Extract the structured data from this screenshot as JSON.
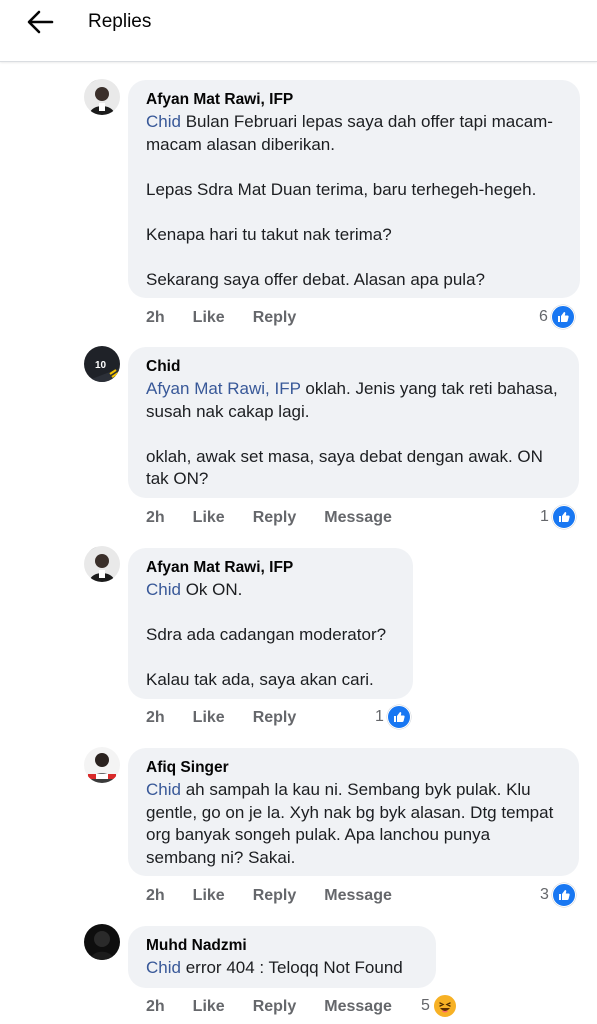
{
  "header": {
    "title": "Replies"
  },
  "comments": [
    {
      "author": "Afyan Mat Rawi, IFP",
      "mention": "Chid",
      "paragraphs": [
        "Bulan Februari lepas saya dah offer tapi macam-macam alasan diberikan.",
        "Lepas Sdra Mat Duan terima, baru terhegeh-hegeh.",
        "Kenapa hari tu takut nak terima?",
        "Sekarang saya offer debat. Alasan apa pula?"
      ],
      "time": "2h",
      "like": "Like",
      "reply": "Reply",
      "reactions": "6"
    },
    {
      "author": "Chid",
      "mention": "Afyan Mat Rawi, IFP",
      "paragraphs": [
        "oklah. Jenis yang tak reti bahasa, susah nak cakap lagi.",
        "oklah, awak set masa, saya debat dengan awak. ON tak ON?"
      ],
      "time": "2h",
      "like": "Like",
      "reply": "Reply",
      "message": "Message",
      "reactions": "1",
      "avatar_text": "10"
    },
    {
      "author": "Afyan Mat Rawi, IFP",
      "mention": "Chid",
      "paragraphs": [
        "Ok ON.",
        "Sdra ada cadangan moderator?",
        "Kalau tak ada, saya akan cari."
      ],
      "time": "2h",
      "like": "Like",
      "reply": "Reply",
      "reactions": "1"
    },
    {
      "author": "Afiq Singer",
      "mention": "Chid",
      "paragraphs": [
        "ah sampah la kau ni. Sembang byk pulak. Klu gentle, go on je la. Xyh nak bg byk alasan. Dtg tempat org banyak songeh pulak. Apa lanchou punya sembang ni? Sakai."
      ],
      "time": "2h",
      "like": "Like",
      "reply": "Reply",
      "message": "Message",
      "reactions": "3"
    },
    {
      "author": "Muhd Nadzmi",
      "mention": "Chid",
      "paragraphs": [
        "error 404 : Teloqq Not Found"
      ],
      "time": "2h",
      "like": "Like",
      "reply": "Reply",
      "message": "Message",
      "reactions": "5"
    }
  ],
  "colors": {
    "mention": "#385898",
    "bubble": "#f0f2f5",
    "like_blue": "#1877f2",
    "haha_yellow": "#f7b125",
    "meta": "#65676b"
  },
  "icons": {
    "back": "back-arrow-icon",
    "like": "like-reaction-icon",
    "haha": "haha-reaction-icon"
  }
}
